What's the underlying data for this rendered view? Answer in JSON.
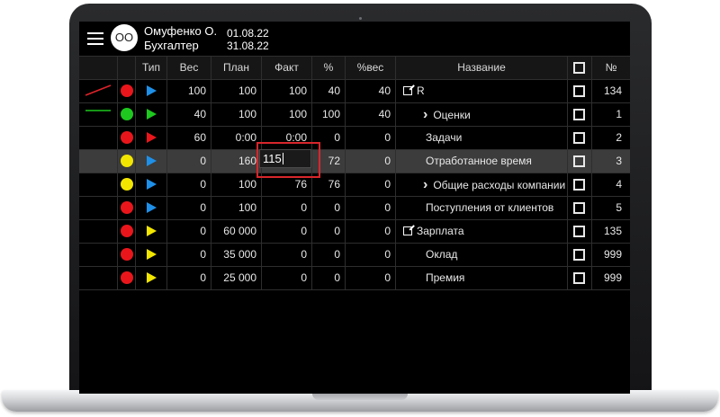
{
  "user": {
    "initials": "ОО",
    "name": "Омуфенко О.",
    "role": "Бухгалтер",
    "date_from": "01.08.22",
    "date_to": "31.08.22"
  },
  "headers": {
    "type": "Тип",
    "ves": "Вес",
    "plan": "План",
    "fakt": "Факт",
    "pct": "%",
    "pves": "%вес",
    "name": "Название",
    "num": "№"
  },
  "colors": {
    "red": "#e8161b",
    "green": "#1ec81e",
    "yellow": "#f2e600",
    "blue": "#1e90e8",
    "trend_red": "#e0232a",
    "trend_green": "#1ec81e",
    "edit_border": "#d8262b"
  },
  "rows": [
    {
      "trend": "red-line",
      "dot": "red",
      "tri": "blue",
      "ves": "100",
      "plan": "100",
      "fakt": "100",
      "pct": "40",
      "pves": "40",
      "name": "R",
      "icon": "external-link-icon",
      "chev": false,
      "indent": 0,
      "num": "134"
    },
    {
      "trend": "green-line",
      "dot": "green",
      "tri": "green",
      "ves": "40",
      "plan": "100",
      "fakt": "100",
      "pct": "100",
      "pves": "40",
      "name": "Оценки",
      "chev": true,
      "indent": 1,
      "num": "1"
    },
    {
      "dot": "red",
      "tri": "red",
      "ves": "60",
      "plan": "0:00",
      "fakt": "0:00",
      "pct": "0",
      "pves": "0",
      "name": "Задачи",
      "chev": false,
      "indent": 2,
      "num": "2"
    },
    {
      "dot": "yellow",
      "tri": "blue",
      "ves": "0",
      "plan": "160",
      "fakt": "",
      "pct": "72",
      "pves": "0",
      "name": "Отработанное время",
      "chev": false,
      "indent": 2,
      "num": "3",
      "selected": true
    },
    {
      "dot": "yellow",
      "tri": "blue",
      "ves": "0",
      "plan": "100",
      "fakt": "76",
      "pct": "76",
      "pves": "0",
      "name": "Общие расходы компании",
      "chev": true,
      "indent": 1,
      "num": "4"
    },
    {
      "dot": "red",
      "tri": "blue",
      "ves": "0",
      "plan": "100",
      "fakt": "0",
      "pct": "0",
      "pves": "0",
      "name": "Поступления от клиентов",
      "chev": false,
      "indent": 2,
      "num": "5"
    },
    {
      "dot": "red",
      "tri": "yellow",
      "ves": "0",
      "plan": "60 000",
      "fakt": "0",
      "pct": "0",
      "pves": "0",
      "name": "Зарплата",
      "icon": "external-link-icon",
      "chev": false,
      "indent": 0,
      "num": "135"
    },
    {
      "dot": "red",
      "tri": "yellow",
      "ves": "0",
      "plan": "35 000",
      "fakt": "0",
      "pct": "0",
      "pves": "0",
      "name": "Оклад",
      "chev": false,
      "indent": 2,
      "num": "999"
    },
    {
      "dot": "red",
      "tri": "yellow",
      "ves": "0",
      "plan": "25 000",
      "fakt": "0",
      "pct": "0",
      "pves": "0",
      "name": "Премия",
      "chev": false,
      "indent": 2,
      "num": "999"
    }
  ],
  "edit": {
    "value": "115"
  }
}
